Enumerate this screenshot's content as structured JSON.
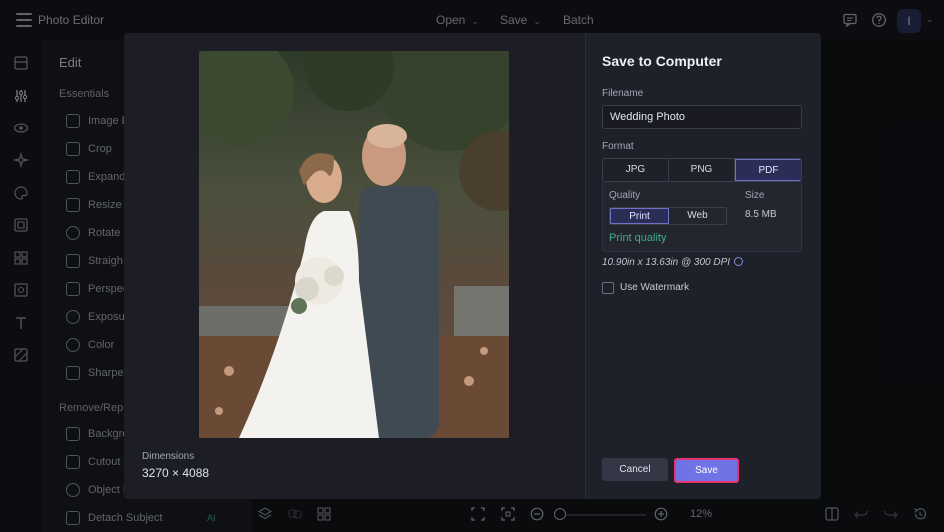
{
  "app": {
    "title": "Photo Editor",
    "menus": [
      {
        "label": "Open",
        "has_dropdown": true
      },
      {
        "label": "Save",
        "has_dropdown": true
      },
      {
        "label": "Batch",
        "has_dropdown": false
      }
    ],
    "avatar_initial": "I"
  },
  "edit_panel": {
    "title": "Edit",
    "sections": [
      {
        "title": "Essentials",
        "tools": [
          "Image E",
          "Crop",
          "Expand",
          "Resize",
          "Rotate",
          "Straigh",
          "Perspec",
          "Exposu",
          "Color",
          "Sharpen"
        ]
      },
      {
        "title": "Remove/Repl",
        "tools": [
          "Backgro",
          "Cutout",
          "Object E",
          "Detach Subject"
        ]
      }
    ],
    "ai_badge": "AI"
  },
  "bottom_toolbar": {
    "zoom_label": "12%"
  },
  "dialog": {
    "title": "Save to Computer",
    "filename_label": "Filename",
    "filename_value": "Wedding Photo",
    "format_label": "Format",
    "formats": [
      "JPG",
      "PNG",
      "PDF"
    ],
    "selected_format": "PDF",
    "quality_label": "Quality",
    "quality_options": [
      "Print",
      "Web"
    ],
    "selected_quality": "Print",
    "quality_note": "Print quality",
    "size_label": "Size",
    "size_value": "8.5 MB",
    "dpi_text": "10.90in x 13.63in @ 300 DPI",
    "watermark_label": "Use Watermark",
    "watermark_checked": false,
    "dimensions_label": "Dimensions",
    "dimensions_value": "3270 × 4088",
    "cancel_label": "Cancel",
    "save_label": "Save"
  },
  "colors": {
    "accent": "#6f73e6",
    "highlight_border": "#e8336f",
    "quality_note": "#3fae87"
  }
}
